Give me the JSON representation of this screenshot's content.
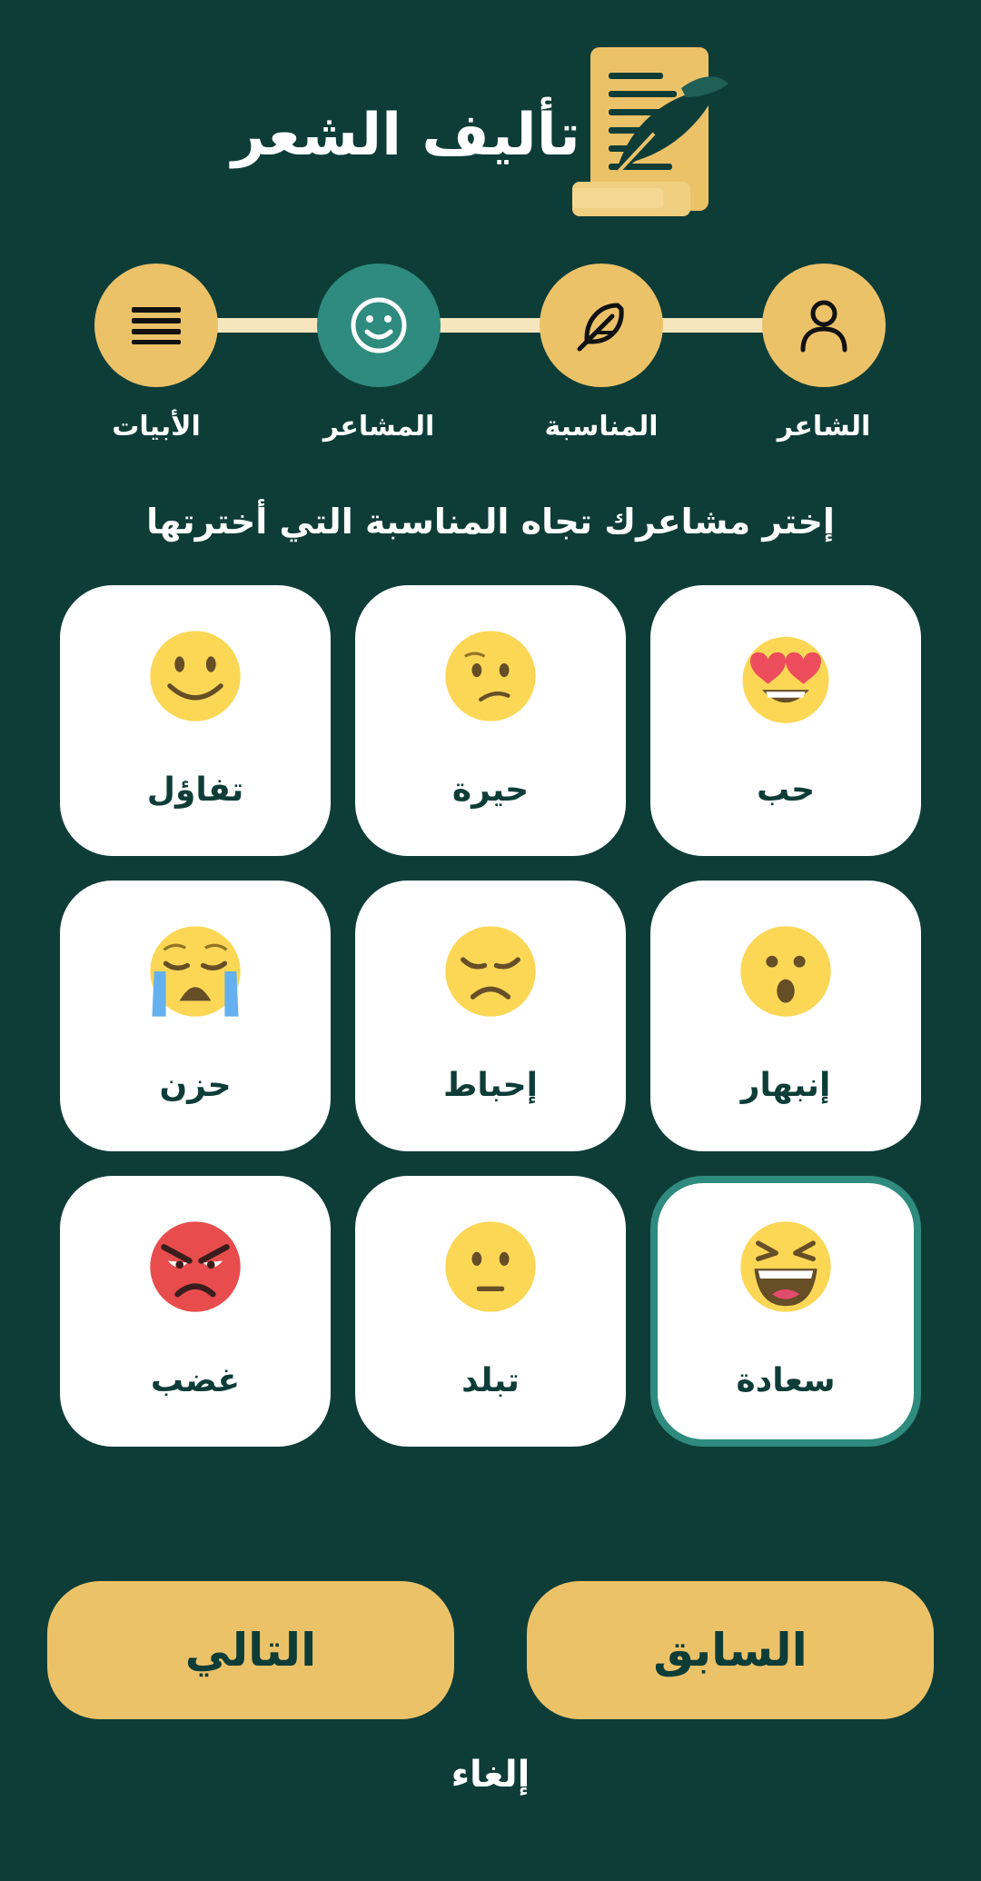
{
  "header": {
    "title": "تأليف الشعر",
    "logo_icon": "poetry-scroll-quill-icon"
  },
  "stepper": {
    "steps": [
      {
        "label": "الشاعر",
        "icon": "user-icon",
        "state": "done"
      },
      {
        "label": "المناسبة",
        "icon": "feather-icon",
        "state": "done"
      },
      {
        "label": "المشاعر",
        "icon": "smile-icon",
        "state": "current"
      },
      {
        "label": "الأبيات",
        "icon": "lines-icon",
        "state": "pending"
      }
    ]
  },
  "prompt": "إختر مشاعرك تجاه المناسبة التي أخترتها",
  "emotions": [
    {
      "label": "حب",
      "icon": "heart-eyes-emoji"
    },
    {
      "label": "حيرة",
      "icon": "confused-emoji"
    },
    {
      "label": "تفاؤل",
      "icon": "smiling-emoji"
    },
    {
      "label": "إنبهار",
      "icon": "astonished-emoji"
    },
    {
      "label": "إحباط",
      "icon": "disappointed-emoji"
    },
    {
      "label": "حزن",
      "icon": "crying-emoji"
    },
    {
      "label": "سعادة",
      "icon": "laughing-emoji",
      "selected": true
    },
    {
      "label": "تبلد",
      "icon": "neutral-emoji"
    },
    {
      "label": "غضب",
      "icon": "angry-emoji"
    }
  ],
  "buttons": {
    "previous": "السابق",
    "next": "التالي",
    "cancel": "إلغاء"
  },
  "colors": {
    "background": "#0e3d38",
    "accent_gold": "#ecc268",
    "active_teal": "#2e8b7e",
    "line_cream": "#f7e6bd",
    "card": "#ffffff"
  }
}
